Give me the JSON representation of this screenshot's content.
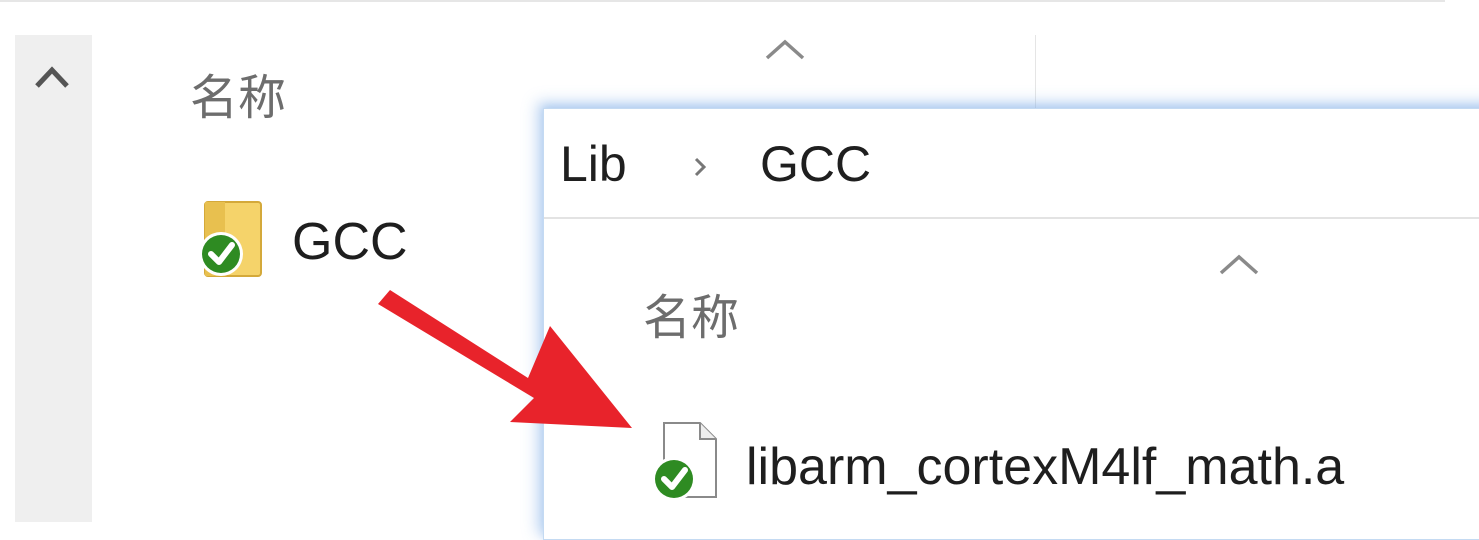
{
  "background_pane": {
    "column_header": "名称",
    "items": [
      {
        "name": "GCC",
        "type": "folder",
        "icon": "folder-icon",
        "status_icon": "sync-ok-check-icon"
      }
    ]
  },
  "foreground_window": {
    "breadcrumb": [
      "Lib",
      "GCC"
    ],
    "column_header": "名称",
    "items": [
      {
        "name": "libarm_cortexM4lf_math.a",
        "type": "file",
        "icon": "document-icon",
        "status_icon": "sync-ok-check-icon"
      }
    ]
  },
  "annotation": {
    "arrow_color": "#e8232b"
  },
  "colors": {
    "check_green": "#2e8b22",
    "folder_yellow": "#f2cd5c",
    "window_border": "#7aaae6"
  }
}
